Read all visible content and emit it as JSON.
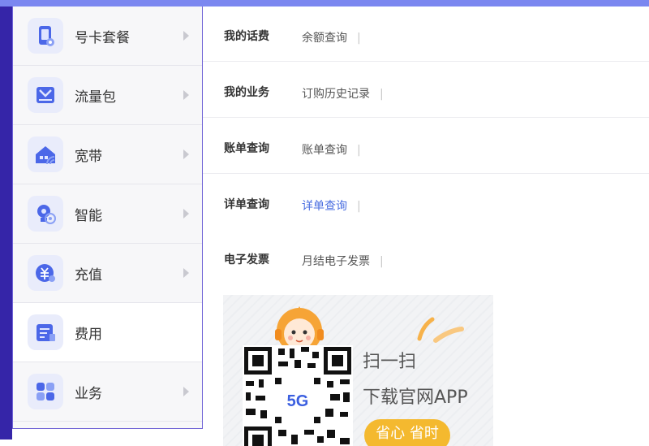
{
  "sidebar": {
    "items": [
      {
        "label": "号卡套餐",
        "icon": "sim-card-icon",
        "active": false
      },
      {
        "label": "流量包",
        "icon": "data-package-icon",
        "active": false
      },
      {
        "label": "宽带",
        "icon": "broadband-icon",
        "active": false
      },
      {
        "label": "智能",
        "icon": "smart-device-icon",
        "active": false
      },
      {
        "label": "充值",
        "icon": "recharge-icon",
        "active": false
      },
      {
        "label": "费用",
        "icon": "bill-icon",
        "active": true
      },
      {
        "label": "业务",
        "icon": "apps-grid-icon",
        "active": false
      }
    ]
  },
  "main": {
    "rows": [
      {
        "title": "我的话费",
        "link": "余额查询"
      },
      {
        "title": "我的业务",
        "link": "订购历史记录"
      },
      {
        "title": "账单查询",
        "link": "账单查询"
      },
      {
        "title": "详单查询",
        "link": "详单查询",
        "highlight": true
      },
      {
        "title": "电子发票",
        "link": "月结电子发票"
      }
    ],
    "separator": "|"
  },
  "promo": {
    "line1": "扫一扫",
    "line2": "下载官网APP",
    "badge": "省心 省时",
    "qr_logo": "5G"
  },
  "colors": {
    "accent": "#4a6ee0",
    "top_bar": "#7b87f0",
    "left_edge": "#3525a8",
    "icon_blue": "#4b67e8",
    "badge": "#f4b92f"
  }
}
